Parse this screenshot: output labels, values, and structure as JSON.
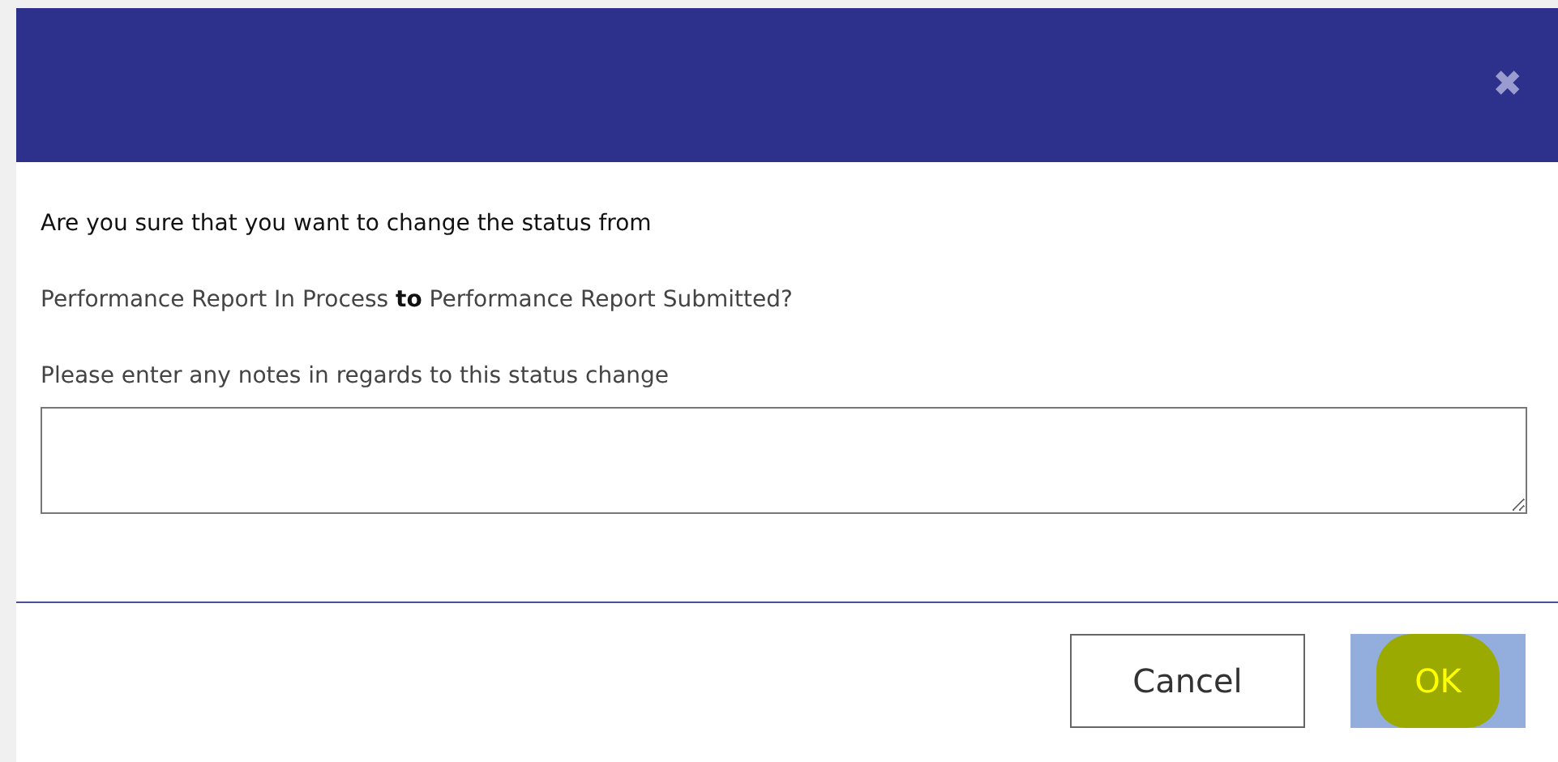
{
  "dialog": {
    "close_icon": "✖",
    "question": "Are you sure that you want to change the status from",
    "transition": "Performance Report In Process **to** Performance Report Submitted?",
    "notes_label": "Please enter any notes in regards to this status change",
    "buttons": [
      {
        "label": "Cancel",
        "kind": "secondary",
        "highlighted": false
      },
      {
        "label": "OK",
        "kind": "primary",
        "highlighted": true
      }
    ]
  }
}
